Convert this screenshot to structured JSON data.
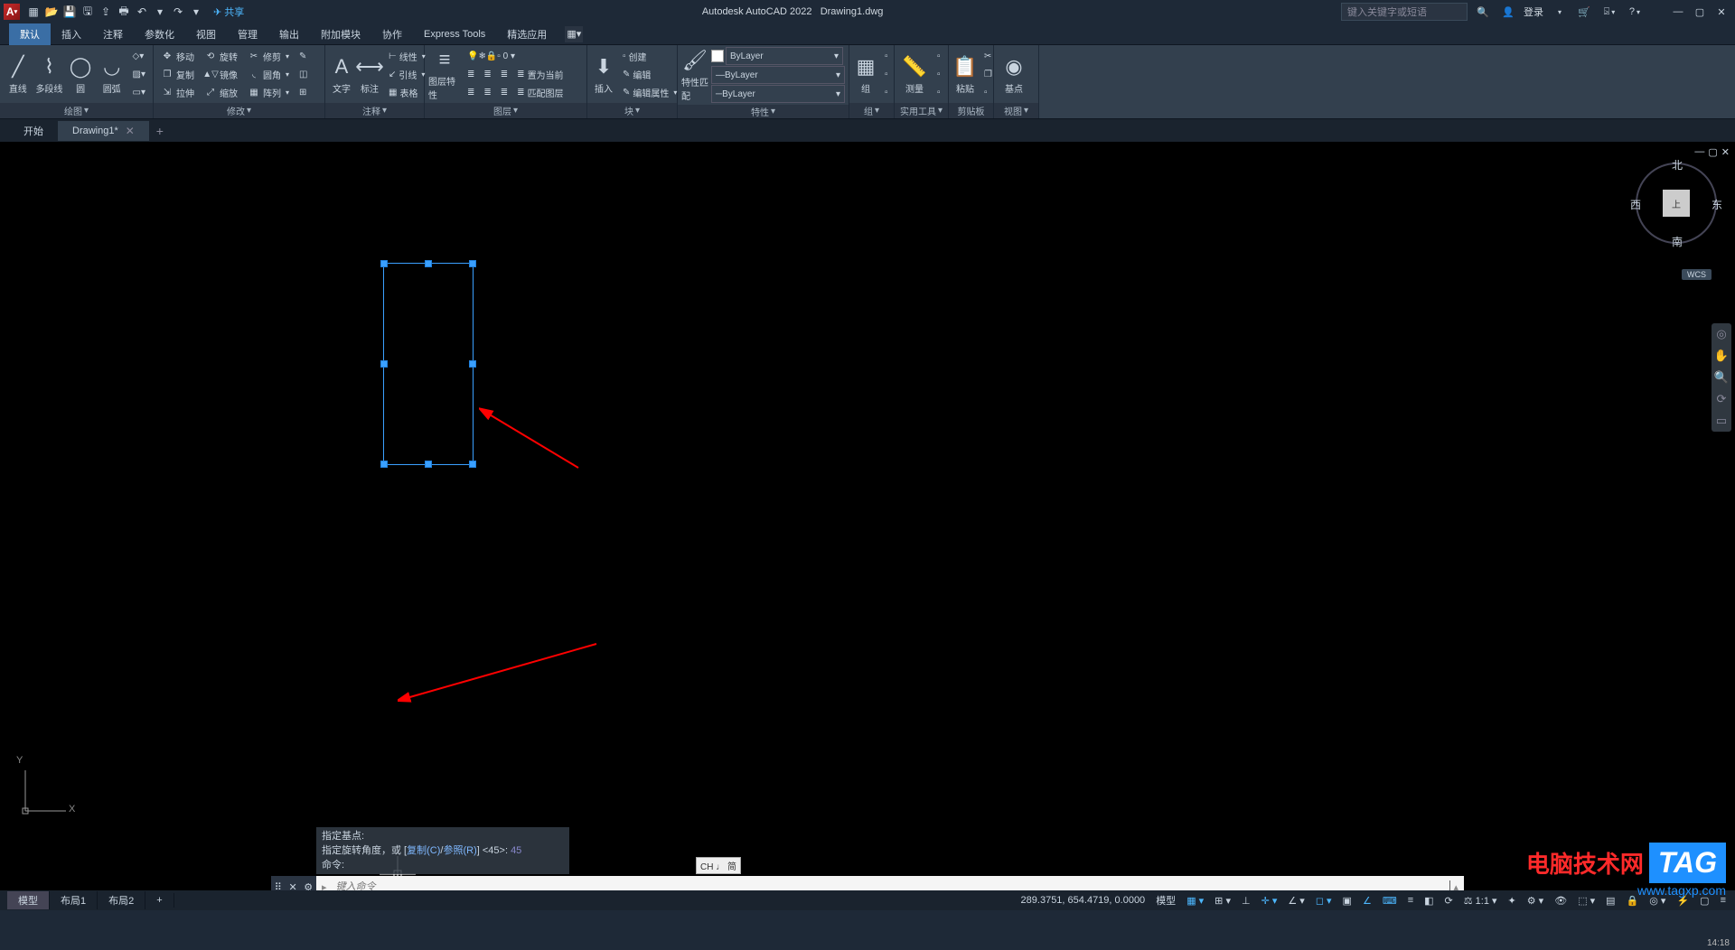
{
  "title": {
    "app": "Autodesk AutoCAD 2022",
    "doc": "Drawing1.dwg"
  },
  "share": "共享",
  "search_placeholder": "键入关键字或短语",
  "login": "登录",
  "menus": [
    "默认",
    "插入",
    "注释",
    "参数化",
    "视图",
    "管理",
    "输出",
    "附加模块",
    "协作",
    "Express Tools",
    "精选应用"
  ],
  "ribbon": {
    "draw": {
      "title": "绘图",
      "line": "直线",
      "polyline": "多段线",
      "circle": "圆",
      "arc": "圆弧"
    },
    "modify": {
      "title": "修改",
      "move": "移动",
      "rotate": "旋转",
      "trim": "修剪",
      "copy": "复制",
      "mirror": "镜像",
      "fillet": "圆角",
      "stretch": "拉伸",
      "scale": "缩放",
      "array": "阵列"
    },
    "annot": {
      "title": "注释",
      "text": "文字",
      "dim": "标注",
      "leader": "引线",
      "table": "表格",
      "linetype": "线性"
    },
    "layers": {
      "title": "图层",
      "props": "图层特性",
      "setcurrent": "置为当前",
      "match": "匹配图层"
    },
    "block": {
      "title": "块",
      "insert": "插入",
      "create": "创建",
      "edit": "编辑",
      "editattr": "编辑属性"
    },
    "props": {
      "title": "特性",
      "match": "特性匹配",
      "bylayer": "ByLayer"
    },
    "group": {
      "title": "组",
      "label": "组"
    },
    "util": {
      "title": "实用工具",
      "measure": "测量"
    },
    "clip": {
      "title": "剪贴板",
      "paste": "粘贴"
    },
    "view": {
      "title": "视图",
      "base": "基点"
    }
  },
  "filetabs": {
    "start": "开始",
    "current": "Drawing1*"
  },
  "viewcube": {
    "n": "北",
    "s": "南",
    "e": "东",
    "w": "西",
    "top": "上",
    "wcs": "WCS"
  },
  "ucs": {
    "x": "X",
    "y": "Y"
  },
  "cmd": {
    "h1": "指定基点:",
    "h2_a": "指定旋转角度，或 [",
    "h2_b": "复制(C)",
    "h2_c": "/",
    "h2_d": "参照(R)",
    "h2_e": "] <45>: ",
    "h2_val": "45",
    "h3": "命令:",
    "placeholder": "键入命令"
  },
  "ime": "CH ♩ 简",
  "layouts": [
    "模型",
    "布局1",
    "布局2"
  ],
  "status": {
    "coords": "289.3751, 654.4719, 0.0000",
    "model": "模型"
  },
  "watermark": {
    "text": "电脑技术网",
    "tag": "TAG",
    "url": "www.tagxp.com"
  },
  "time": "14:18"
}
